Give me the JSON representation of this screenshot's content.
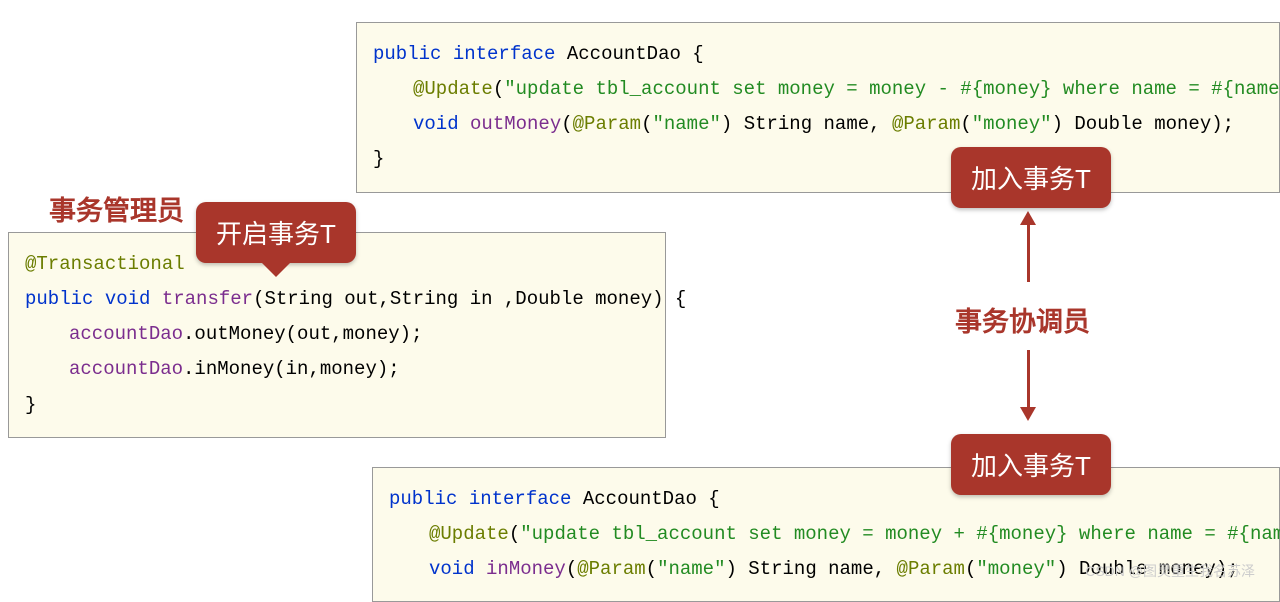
{
  "labels": {
    "admin": "事务管理员",
    "coordinator": "事务协调员"
  },
  "callouts": {
    "open": "开启事务T",
    "join1": "加入事务T",
    "join2": "加入事务T"
  },
  "codeTop": {
    "l1_kw1": "public",
    "l1_kw2": "interface",
    "l1_name": "AccountDao",
    "l1_brace": " {",
    "l2_ann": "@Update",
    "l2_p1": "(",
    "l2_str": "\"update tbl_account set money = money - #{money} where name = #{name}\"",
    "l2_p2": ")",
    "l3_kw": "void",
    "l3_m": "outMoney",
    "l3_p1": "(",
    "l3_ann1": "@Param",
    "l3_pp1": "(",
    "l3_str1": "\"name\"",
    "l3_pp2": ")",
    "l3_t1": " String name, ",
    "l3_ann2": "@Param",
    "l3_pp3": "(",
    "l3_str2": "\"money\"",
    "l3_pp4": ")",
    "l3_t2": " Double money);",
    "l4": "}"
  },
  "codeLeft": {
    "l1_ann": "@Transactional",
    "l2_kw1": "public",
    "l2_kw2": "void",
    "l2_m": "transfer",
    "l2_args": "(String out,String in ,Double money) {",
    "l3_obj": "accountDao",
    "l3_rest": ".outMoney(out,money);",
    "l4_obj": "accountDao",
    "l4_rest": ".inMoney(in,money);",
    "l5": "}"
  },
  "codeBottom": {
    "l1_kw1": "public",
    "l1_kw2": "interface",
    "l1_name": "AccountDao",
    "l1_brace": " {",
    "l2_ann": "@Update",
    "l2_p1": "(",
    "l2_str": "\"update tbl_account set money = money + #{money} where name = #{name}\"",
    "l2_p2": ")",
    "l3_kw": "void",
    "l3_m": "inMoney",
    "l3_p1": "(",
    "l3_ann1": "@Param",
    "l3_pp1": "(",
    "l3_str1": "\"name\"",
    "l3_pp2": ")",
    "l3_t1": " String name, ",
    "l3_ann2": "@Param",
    "l3_pp3": "(",
    "l3_str2": "\"money\"",
    "l3_pp4": ")",
    "l3_t2": " Double money);"
  },
  "watermark": "CSDN @图灵重生我名苏泽"
}
